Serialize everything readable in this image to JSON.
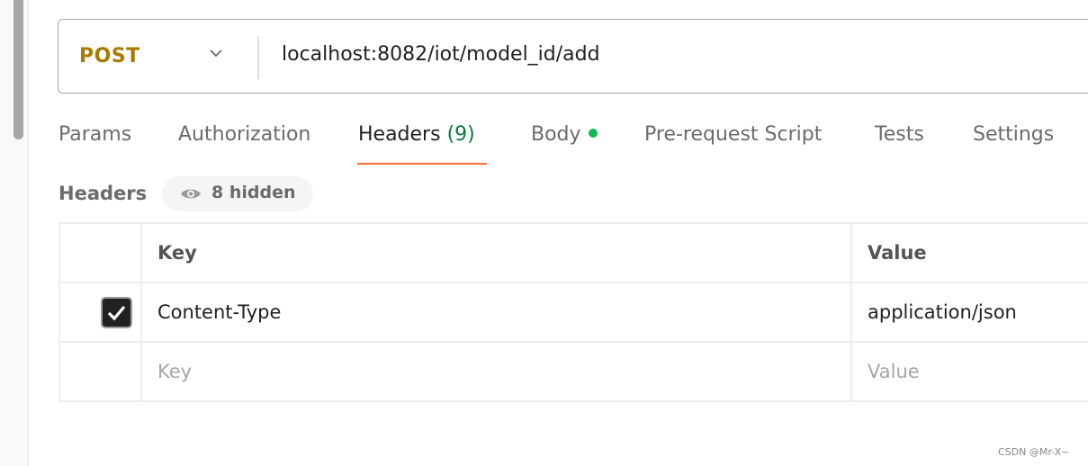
{
  "request": {
    "method": "POST",
    "url": "localhost:8082/iot/model_id/add"
  },
  "tabs": [
    {
      "label": "Params"
    },
    {
      "label": "Authorization"
    },
    {
      "label": "Headers",
      "count": "(9)"
    },
    {
      "label": "Body"
    },
    {
      "label": "Pre-request Script"
    },
    {
      "label": "Tests"
    },
    {
      "label": "Settings"
    }
  ],
  "headers": {
    "title": "Headers",
    "hidden": "8 hidden",
    "columns": {
      "key": "Key",
      "value": "Value"
    },
    "rows": [
      {
        "checked": true,
        "key": "Content-Type",
        "value": "application/json"
      }
    ],
    "placeholder": {
      "key": "Key",
      "value": "Value"
    }
  },
  "watermark": "CSDN @Mr-X~",
  "colors": {
    "method": "#a67c00",
    "active_tab_underline": "#ff6c37",
    "body_dot": "#0cbb52",
    "count": "#0b7a3b"
  }
}
